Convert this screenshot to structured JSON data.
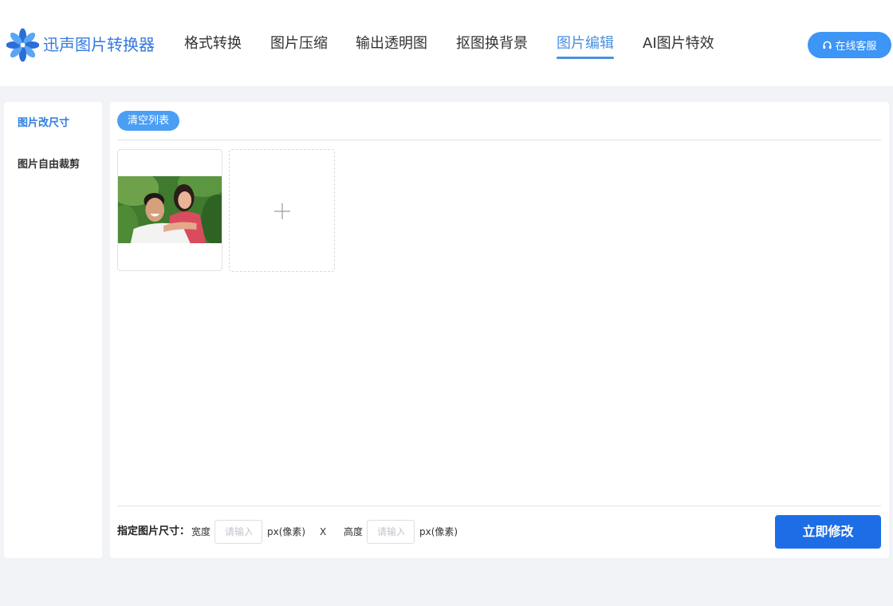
{
  "app": {
    "title": "迅声图片转换器",
    "logo_icon": "flower-logo-icon"
  },
  "nav": {
    "items": [
      {
        "label": "格式转换",
        "active": false
      },
      {
        "label": "图片压缩",
        "active": false
      },
      {
        "label": "输出透明图",
        "active": false
      },
      {
        "label": "抠图换背景",
        "active": false
      },
      {
        "label": "图片编辑",
        "active": true
      },
      {
        "label": "AI图片特效",
        "active": false
      }
    ],
    "service_button": {
      "label": "在线客服",
      "icon": "headphone-icon"
    }
  },
  "sidebar": {
    "items": [
      {
        "label": "图片改尺寸",
        "active": true
      },
      {
        "label": "图片自由裁剪",
        "active": false
      }
    ]
  },
  "file_list": {
    "clear_label": "清空列表",
    "add_icon": "plus-icon"
  },
  "resize": {
    "label": "指定图片尺寸：",
    "width_label": "宽度",
    "width_placeholder": "请输入",
    "width_value": "",
    "width_unit": "px(像素)",
    "separator": "X",
    "height_label": "高度",
    "height_placeholder": "请输入",
    "height_value": "",
    "height_unit": "px(像素)",
    "submit_label": "立即修改"
  },
  "colors": {
    "accent": "#3d95f6",
    "nav_active": "#4a90e2",
    "sidebar_active": "#2d7ce0",
    "logo_text": "#3479df",
    "primary_button": "#1d6ee6",
    "page_bg": "#f2f3f7",
    "text": "#333333"
  }
}
